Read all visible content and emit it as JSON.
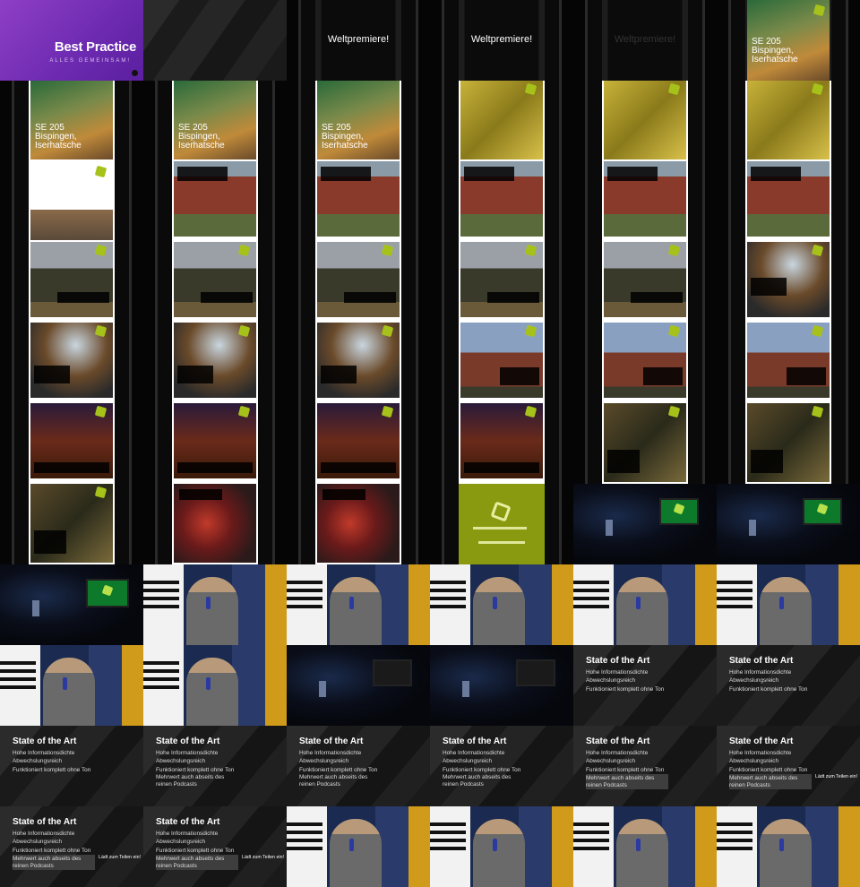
{
  "best_practice": {
    "title": "Best Practice",
    "subtitle": "ALLES GEMEINSAM!"
  },
  "premiere_label": "Weltpremiere!",
  "cover": {
    "title_line1": "SE 205",
    "title_line2": "Bispingen,",
    "title_line3": "Iserhatsche"
  },
  "slide": {
    "title": "State of the Art",
    "bullets": [
      "Hohe Informationsdichte",
      "Abwechslungsreich",
      "Funktioniert komplett ohne Ton",
      "Mehrwert auch abseits des reinen Podcasts"
    ],
    "share_note": "Lädt zum Teilen ein!"
  },
  "colors": {
    "purple": "#7e34bd",
    "lime": "#a6c21a",
    "olive": "#8a9a10"
  }
}
